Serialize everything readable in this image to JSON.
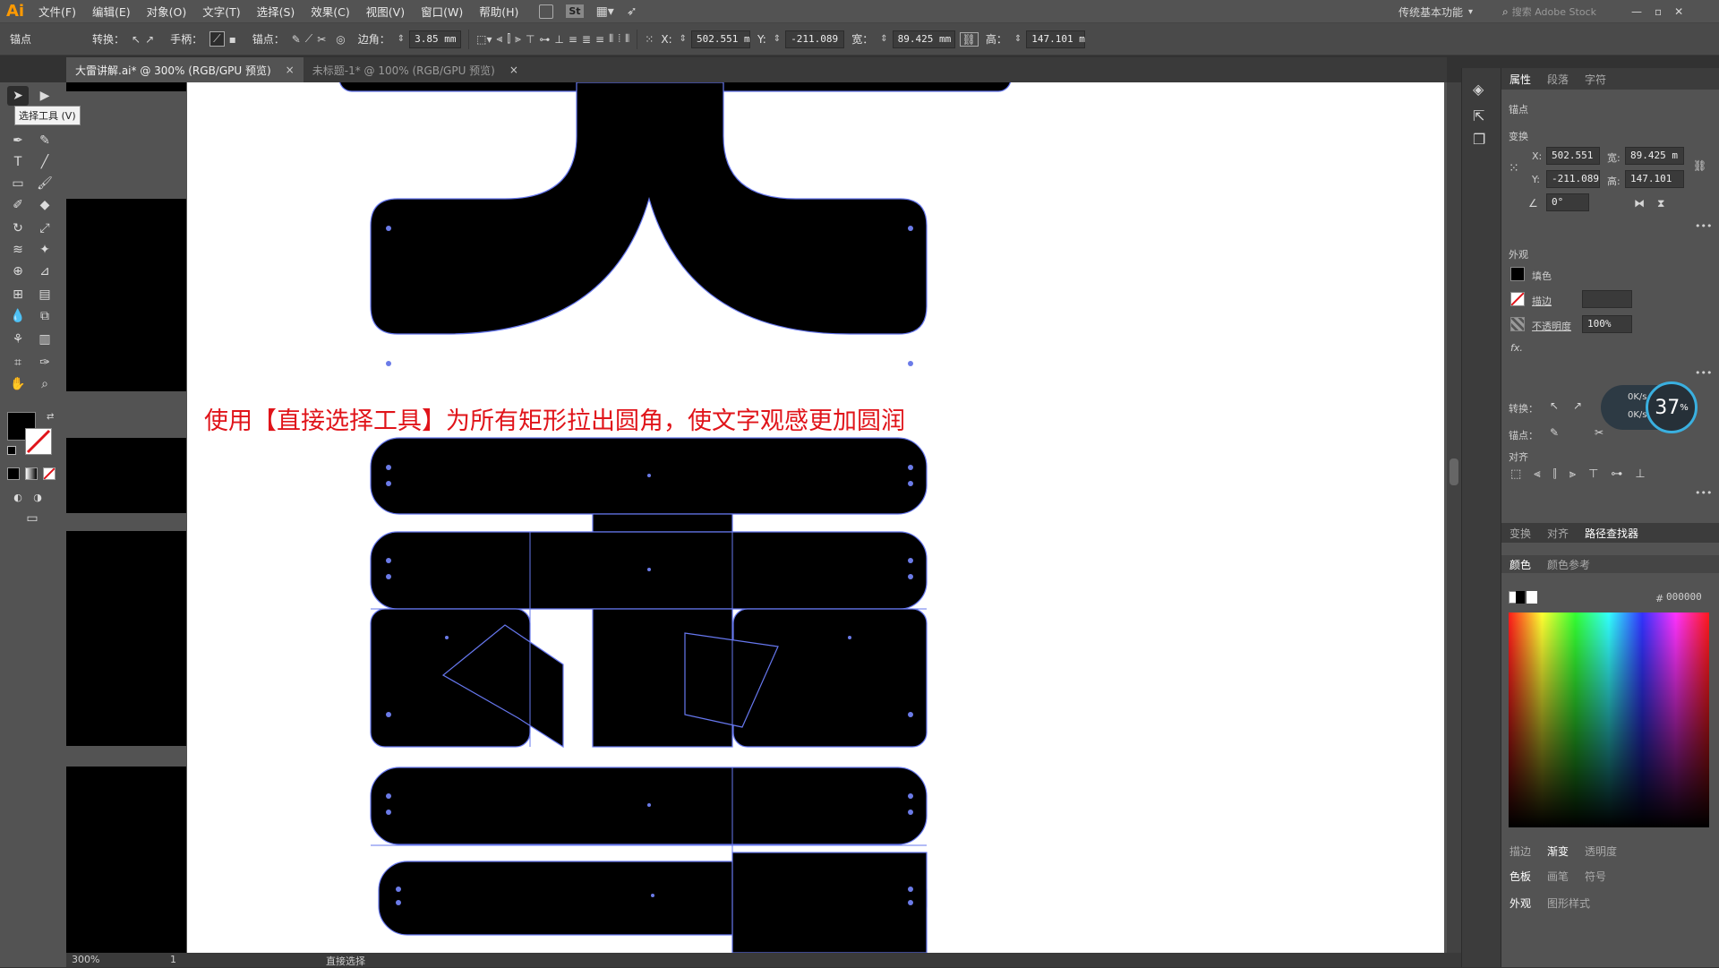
{
  "app": {
    "logo": "Ai"
  },
  "menubar": {
    "items": [
      "文件(F)",
      "编辑(E)",
      "对象(O)",
      "文字(T)",
      "选择(S)",
      "效果(C)",
      "视图(V)",
      "窗口(W)",
      "帮助(H)"
    ],
    "bridge_label": "St",
    "workspace": "传统基本功能",
    "stock_search": "搜索 Adobe Stock",
    "win_min": "—",
    "win_max": "▫",
    "win_close": "✕"
  },
  "control": {
    "anchor_label": "锚点",
    "convert_label": "转换：",
    "handle_label": "手柄：",
    "anchors_label": "锚点：",
    "corner_label": "边角：",
    "corner_value": "3.85 mm",
    "x_label": "X:",
    "x_value": "502.551 m",
    "y_label": "Y:",
    "y_value": "-211.089",
    "w_label": "宽：",
    "w_value": "89.425 mm",
    "h_label": "高：",
    "h_value": "147.101 m"
  },
  "tabs": [
    {
      "label": "大雷讲解.ai* @ 300% (RGB/GPU 预览)",
      "close": "×"
    },
    {
      "label": "未标题-1* @ 100% (RGB/GPU 预览)",
      "close": "×"
    }
  ],
  "tooltip": "选择工具 (V)",
  "caption": "使用【直接选择工具】为所有矩形拉出圆角，使文字观感更加圆润",
  "panel": {
    "tabs": [
      "属性",
      "段落",
      "字符"
    ],
    "anchor_section": "锚点",
    "transform_section": "变换",
    "x_label": "X:",
    "x": "502.551",
    "y_label": "Y:",
    "y": "-211.089",
    "w_label": "宽:",
    "w": "89.425 m",
    "h_label": "高:",
    "h": "147.101",
    "angle": "0°",
    "appearance_section": "外观",
    "fill_label": "填色",
    "stroke_label": "描边",
    "opacity_label": "不透明度",
    "opacity_value": "100%",
    "fx_label": "fx.",
    "convert_label": "转换：",
    "anchor_label2": "锚点：",
    "align_section": "对齐",
    "tabs2": [
      "变换",
      "对齐",
      "路径查找器"
    ],
    "color_tabs": [
      "颜色",
      "颜色参考"
    ],
    "hex_label": "#",
    "hex_value": "000000",
    "bottom_tabs1": [
      "描边",
      "渐变",
      "透明度"
    ],
    "bottom_tabs2": [
      "色板",
      "画笔",
      "符号"
    ],
    "bottom_tabs3": [
      "外观",
      "图形样式"
    ]
  },
  "net_widget": {
    "up": "0K/s",
    "down": "0K/s",
    "percent": "37",
    "percent_unit": "%"
  },
  "status": {
    "zoom": "300%",
    "page": "1",
    "tool": "直接选择"
  },
  "colors": {
    "caption": "#e0141a",
    "selection": "#6677ee",
    "app_bg": "#535353"
  }
}
